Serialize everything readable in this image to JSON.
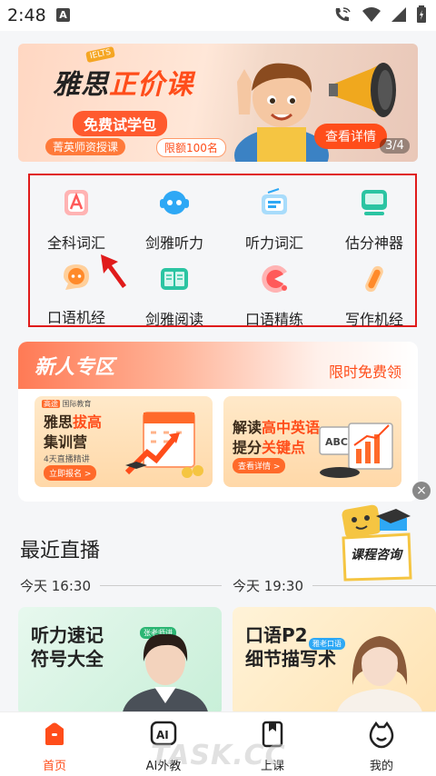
{
  "status_bar": {
    "time": "2:48",
    "badge": "A"
  },
  "banner": {
    "tag": "IELTS",
    "title_part1": "雅思",
    "title_part2": "正价课",
    "subtitle": "免费试学包",
    "teacher": "菁英师资授课",
    "limit": "限额100名",
    "detail_button": "查看详情",
    "pager": "3/4"
  },
  "grid": {
    "items": [
      {
        "label": "全科词汇",
        "icon": "letter-a-icon",
        "color": "#ff6b6b"
      },
      {
        "label": "剑雅听力",
        "icon": "headphone-robot-icon",
        "color": "#2ea8f5"
      },
      {
        "label": "听力词汇",
        "icon": "radio-icon",
        "color": "#2ea8f5"
      },
      {
        "label": "估分神器",
        "icon": "monitor-icon",
        "color": "#2bc4a2"
      },
      {
        "label": "口语机经",
        "icon": "chat-bubble-icon",
        "color": "#ff8a2a"
      },
      {
        "label": "剑雅阅读",
        "icon": "open-book-icon",
        "color": "#2bc4a2"
      },
      {
        "label": "口语精练",
        "icon": "pacman-icon",
        "color": "#ff6b6b"
      },
      {
        "label": "写作机经",
        "icon": "pen-icon",
        "color": "#ff8a2a"
      }
    ]
  },
  "newcomer": {
    "title": "新人专区",
    "free_label": "限时免费领",
    "card1": {
      "brand_tag": "高途",
      "brand": "国际教育",
      "line1_a": "雅思",
      "line1_b": "拔高",
      "line2": "集训营",
      "small": "4天直播精讲",
      "button": "立即报名 >"
    },
    "card2": {
      "line1_a": "解读",
      "line1_b": "高中英语",
      "line2_a": "提分",
      "line2_b": "关键点",
      "button": "查看详情 >"
    }
  },
  "float": {
    "close": "×",
    "label": "课程咨询"
  },
  "live": {
    "title": "最近直播",
    "times": [
      "今天 16:30",
      "今天 19:30"
    ],
    "cards": [
      {
        "line1": "听力速记",
        "line2": "符号大全",
        "tag": "张老师讲"
      },
      {
        "line1": "口语P2",
        "line2": "细节描写术",
        "tag": "雅老口语"
      }
    ]
  },
  "nav": {
    "items": [
      {
        "label": "首页",
        "icon": "home-icon",
        "active": true
      },
      {
        "label": "AI外教",
        "icon": "ai-icon",
        "active": false
      },
      {
        "label": "上课",
        "icon": "class-icon",
        "active": false
      },
      {
        "label": "我的",
        "icon": "profile-icon",
        "active": false
      }
    ]
  },
  "watermark": "TASK.CC",
  "colors": {
    "accent": "#ff4d1a",
    "highlight_box": "#e01b1b"
  }
}
